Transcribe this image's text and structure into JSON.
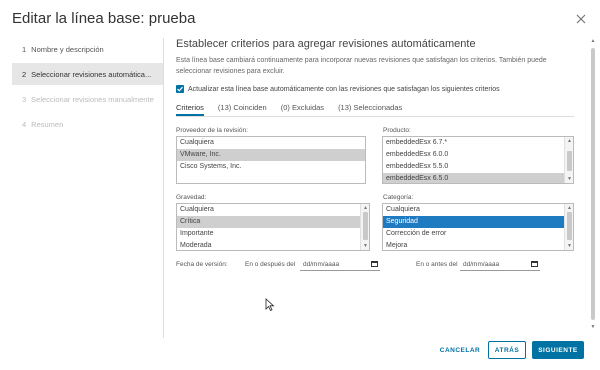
{
  "dialog": {
    "title": "Editar la línea base: prueba"
  },
  "steps": [
    {
      "num": "1",
      "label": "Nombre y descripción",
      "state": "normal"
    },
    {
      "num": "2",
      "label": "Seleccionar revisiones automática...",
      "state": "active"
    },
    {
      "num": "3",
      "label": "Seleccionar revisiones manualmente",
      "state": "disabled"
    },
    {
      "num": "4",
      "label": "Resumen",
      "state": "disabled"
    }
  ],
  "main": {
    "heading": "Establecer criterios para agregar revisiones automáticamente",
    "description": "Esta línea base cambiará continuamente para incorporar nuevas revisiones que satisfagan los criterios. También puede seleccionar revisiones para excluir.",
    "auto_update_label": "Actualizar esta línea base automáticamente con las revisiones que satisfagan los siguientes criterios",
    "auto_update_checked": true
  },
  "tabs": [
    {
      "label": "Criterios",
      "active": true
    },
    {
      "label": "(13) Coinciden",
      "active": false
    },
    {
      "label": "(0) Excluidas",
      "active": false
    },
    {
      "label": "(13) Seleccionadas",
      "active": false
    }
  ],
  "vendor": {
    "label": "Proveedor de la revisión:",
    "options": [
      "Cualquiera",
      "VMware, Inc.",
      "Cisco Systems, Inc."
    ],
    "selected": [
      1
    ]
  },
  "product": {
    "label": "Producto:",
    "options": [
      "embeddedEsx 6.7.*",
      "embeddedEsx 6.0.0",
      "embeddedEsx 5.5.0",
      "embeddedEsx 6.5.0"
    ],
    "selected": [
      3
    ]
  },
  "severity": {
    "label": "Gravedad:",
    "options": [
      "Cualquiera",
      "Crítica",
      "Importante",
      "Moderada"
    ],
    "selected": [
      1
    ]
  },
  "category": {
    "label": "Categoría:",
    "options": [
      "Cualquiera",
      "Seguridad",
      "Corrección de error",
      "Mejora"
    ],
    "selected": [
      1
    ]
  },
  "dates": {
    "label": "Fecha de versión:",
    "on_or_after_label": "En o después del",
    "on_or_after_placeholder": "dd/mm/aaaa",
    "on_or_before_label": "En o antes del",
    "on_or_before_placeholder": "dd/mm/aaaa"
  },
  "buttons": {
    "cancel": "CANCELAR",
    "back": "ATRÁS",
    "next": "SIGUIENTE"
  },
  "colors": {
    "accent": "#0072a3",
    "selection_blue": "#1e7bc1",
    "selection_gray": "#cfcfcf"
  }
}
